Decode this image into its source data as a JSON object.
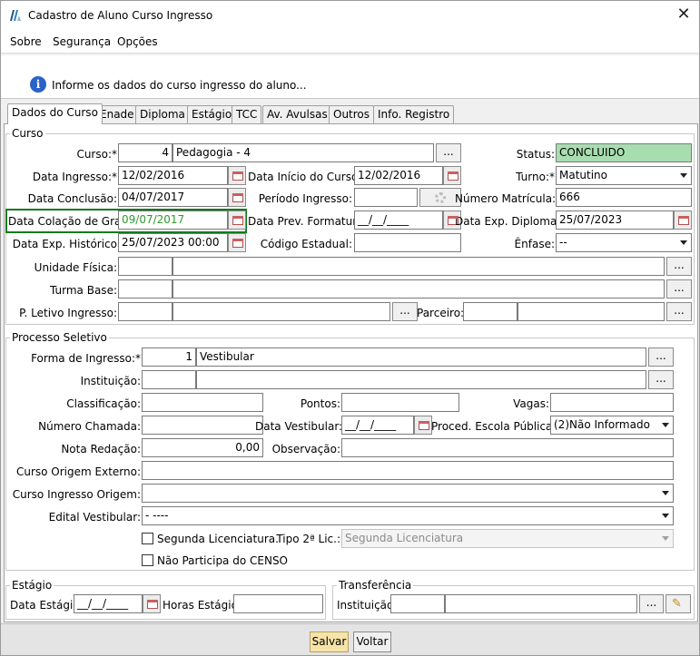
{
  "window": {
    "title": "Cadastro de Aluno Curso Ingresso",
    "close": "✕"
  },
  "menu": {
    "sobre": "Sobre",
    "seguranca": "Segurança",
    "opcoes": "Opções"
  },
  "info": {
    "message": "Informe os dados do curso ingresso do aluno..."
  },
  "tabs": [
    "Dados do Curso",
    "Enade",
    "Diploma",
    "Estágio",
    "TCC",
    "Av. Avulsas",
    "Outros",
    "Info. Registro"
  ],
  "curso": {
    "legend": "Curso",
    "curso_label": "Curso:*",
    "curso_code": "4",
    "curso_name": "Pedagogia - 4",
    "status_label": "Status:",
    "status_value": "CONCLUIDO",
    "data_ingresso_label": "Data Ingresso:*",
    "data_ingresso": "12/02/2016",
    "data_inicio_label": "Data Início do Curso:",
    "data_inicio": "12/02/2016",
    "turno_label": "Turno:*",
    "turno": "Matutino",
    "data_conclusao_label": "Data Conclusão:",
    "data_conclusao": "04/07/2017",
    "periodo_ingresso_label": "Período Ingresso:",
    "periodo_ingresso": "",
    "numero_matricula_label": "Número Matrícula:",
    "numero_matricula": "666",
    "data_colacao_label": "Data Colação de Grau:",
    "data_colacao": "09/07/2017",
    "data_prev_formatura_label": "Data Prev. Formatura:",
    "data_prev_formatura": "__/__/____",
    "data_exp_diploma_label": "Data Exp. Diploma:",
    "data_exp_diploma": "25/07/2023",
    "data_exp_historico_label": "Data Exp. Histórico",
    "data_exp_historico": "25/07/2023 00:00",
    "codigo_estadual_label": "Código Estadual:",
    "codigo_estadual": "",
    "enfase_label": "Ênfase:",
    "enfase": "--",
    "unidade_fisica_label": "Unidade Física:",
    "turma_base_label": "Turma Base:",
    "p_letivo_label": "P. Letivo Ingresso:",
    "parceiro_label": "Parceiro:"
  },
  "processo": {
    "legend": "Processo Seletivo",
    "forma_ingresso_label": "Forma de Ingresso:*",
    "forma_ingresso_code": "1",
    "forma_ingresso_name": "Vestibular",
    "instituicao_label": "Instituição:",
    "classificacao_label": "Classificação:",
    "pontos_label": "Pontos:",
    "vagas_label": "Vagas:",
    "numero_chamada_label": "Número Chamada:",
    "data_vestibular_label": "Data Vestibular:",
    "data_vestibular": "__/__/____",
    "proced_escola_label": "Proced. Escola Pública:*",
    "proced_escola": "(2)Não Informado",
    "nota_redacao_label": "Nota Redação:",
    "nota_redacao": "0,00",
    "observacao_label": "Observação:",
    "curso_origem_externo_label": "Curso Origem Externo:",
    "curso_ingresso_origem_label": "Curso Ingresso Origem:",
    "edital_vestibular_label": "Edital Vestibular:",
    "edital_vestibular": "- ----",
    "segunda_lic_label": "Segunda Licenciatura.",
    "tipo_2a_lic_label": "Tipo 2ª Lic.:",
    "tipo_2a_lic": "Segunda Licenciatura",
    "nao_participa_censo_label": "Não Participa do CENSO"
  },
  "estagio": {
    "legend": "Estágio",
    "data_label": "Data Estágio:",
    "data": "__/__/____",
    "horas_label": "Horas Estágio:"
  },
  "transferencia": {
    "legend": "Transferência",
    "instituicao_label": "Instituição:"
  },
  "buttons": {
    "ellipsis": "...",
    "salvar": "Salvar",
    "voltar": "Voltar"
  }
}
